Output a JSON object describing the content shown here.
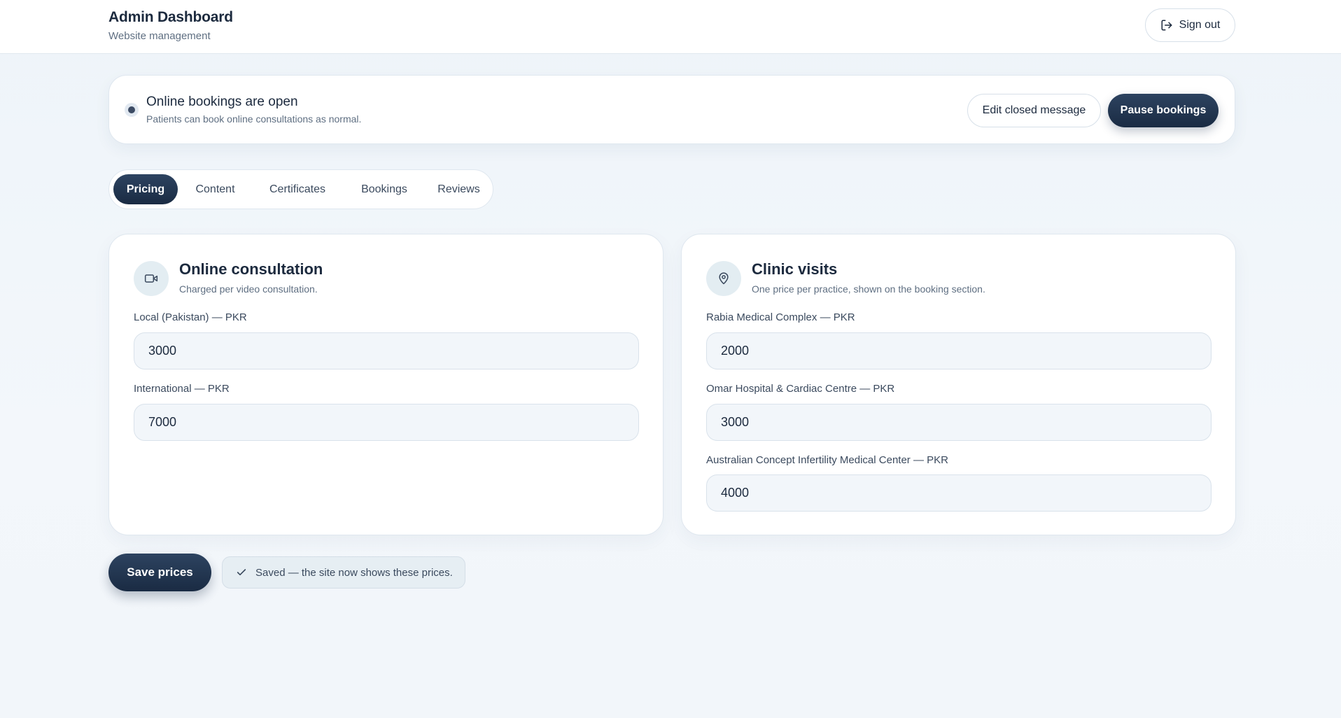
{
  "header": {
    "title": "Admin Dashboard",
    "subtitle": "Website management",
    "signout_label": "Sign out"
  },
  "status": {
    "title": "Online bookings are open",
    "subtitle": "Patients can book online consultations as normal.",
    "edit_label": "Edit closed message",
    "pause_label": "Pause bookings"
  },
  "tabs": [
    {
      "label": "Pricing",
      "active": true
    },
    {
      "label": "Content",
      "active": false
    },
    {
      "label": "Certificates",
      "active": false
    },
    {
      "label": "Bookings",
      "active": false
    },
    {
      "label": "Reviews",
      "active": false
    }
  ],
  "online": {
    "icon": "video-icon",
    "title": "Online consultation",
    "subtitle": "Charged per video consultation.",
    "fields": [
      {
        "label": "Local (Pakistan) — PKR",
        "value": "3000"
      },
      {
        "label": "International — PKR",
        "value": "7000"
      }
    ]
  },
  "clinic": {
    "icon": "map-pin-icon",
    "title": "Clinic visits",
    "subtitle": "One price per practice, shown on the booking section.",
    "fields": [
      {
        "label": "Rabia Medical Complex — PKR",
        "value": "2000"
      },
      {
        "label": "Omar Hospital & Cardiac Centre — PKR",
        "value": "3000"
      },
      {
        "label": "Australian Concept Infertility Medical Center — PKR",
        "value": "4000"
      }
    ]
  },
  "actions": {
    "save_label": "Save prices",
    "saved_message": "Saved — the site now shows these prices."
  },
  "colors": {
    "primary_dark": "#1a2b43",
    "accent_soft": "#e3edf2",
    "background": "#eef4f9"
  }
}
